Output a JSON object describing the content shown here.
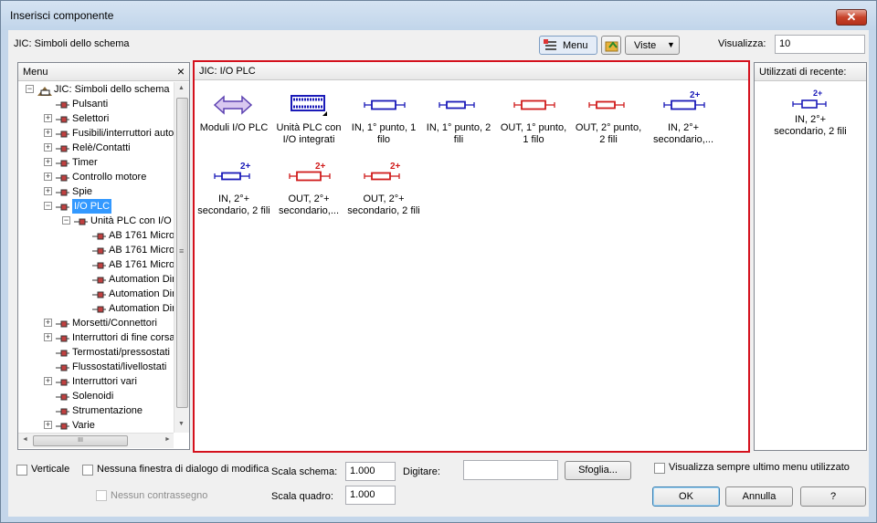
{
  "window": {
    "title": "Inserisci componente",
    "close": "✕"
  },
  "top": {
    "breadcrumb": "JIC: Simboli dello schema",
    "menu_btn": "Menu",
    "viste_btn": "Viste",
    "visualizza_label": "Visualizza:",
    "visualizza_value": "10"
  },
  "left_panel": {
    "title": "Menu",
    "close": "×"
  },
  "tree": [
    {
      "label": "JIC: Simboli dello schema"
    },
    {
      "label": "Pulsanti"
    },
    {
      "label": "Selettori"
    },
    {
      "label": "Fusibili/interruttori autor"
    },
    {
      "label": "Relè/Contatti"
    },
    {
      "label": "Timer"
    },
    {
      "label": "Controllo motore"
    },
    {
      "label": "Spie"
    },
    {
      "label": "I/O PLC"
    },
    {
      "label": "Unità PLC con I/O"
    },
    {
      "label": "AB 1761 Micro"
    },
    {
      "label": "AB 1761 Micro"
    },
    {
      "label": "AB 1761 Micro"
    },
    {
      "label": "Automation Dire"
    },
    {
      "label": "Automation Dire"
    },
    {
      "label": "Automation Dire"
    },
    {
      "label": "Morsetti/Connettori"
    },
    {
      "label": "Interruttori di fine corsa"
    },
    {
      "label": "Termostati/pressostati"
    },
    {
      "label": "Flussostati/livellostati"
    },
    {
      "label": "Interruttori vari"
    },
    {
      "label": "Solenoidi"
    },
    {
      "label": "Strumentazione"
    },
    {
      "label": "Varie"
    }
  ],
  "scroll": {
    "up": "▲",
    "down": "▼",
    "left": "◄",
    "right": "►",
    "thumb": "III",
    "vgrip": "≡"
  },
  "center": {
    "title": "JIC: I/O PLC",
    "items": [
      {
        "l1": "Moduli I/O PLC",
        "l2": ""
      },
      {
        "l1": "Unità PLC con",
        "l2": "I/O integrati"
      },
      {
        "l1": "IN, 1° punto, 1",
        "l2": "filo"
      },
      {
        "l1": "IN, 1° punto, 2",
        "l2": "fili"
      },
      {
        "l1": "OUT, 1° punto,",
        "l2": "1 filo"
      },
      {
        "l1": "OUT, 2° punto,",
        "l2": "2 fili"
      },
      {
        "l1": "IN, 2°+",
        "l2": "secondario,..."
      },
      {
        "l1": "IN, 2°+",
        "l2": "secondario, 2 fili"
      },
      {
        "l1": "OUT, 2°+",
        "l2": "secondario,..."
      },
      {
        "l1": "OUT, 2°+",
        "l2": "secondario, 2 fili"
      }
    ],
    "badge": "2+"
  },
  "recent": {
    "title": "Utilizzati di recente:",
    "item_l1": "IN, 2°+",
    "item_l2": "secondario, 2 fili",
    "badge": "2+"
  },
  "bottom": {
    "verticale": "Verticale",
    "nessuna_finestra": "Nessuna finestra di dialogo di modifica",
    "nessun_contrassegno": "Nessun contrassegno",
    "scala_schema_label": "Scala schema:",
    "scala_schema_value": "1.000",
    "scala_quadro_label": "Scala quadro:",
    "scala_quadro_value": "1.000",
    "digitare_label": "Digitare:",
    "digitare_value": "",
    "sfoglia": "Sfoglia...",
    "visualizza_sempre": "Visualizza sempre ultimo menu utilizzato",
    "ok": "OK",
    "annulla": "Annulla",
    "help": "?"
  },
  "colors": {
    "blue": "#1a1ab8",
    "red": "#d01c1c",
    "highlight": "#3399ff",
    "red_frame": "#d4111d"
  }
}
